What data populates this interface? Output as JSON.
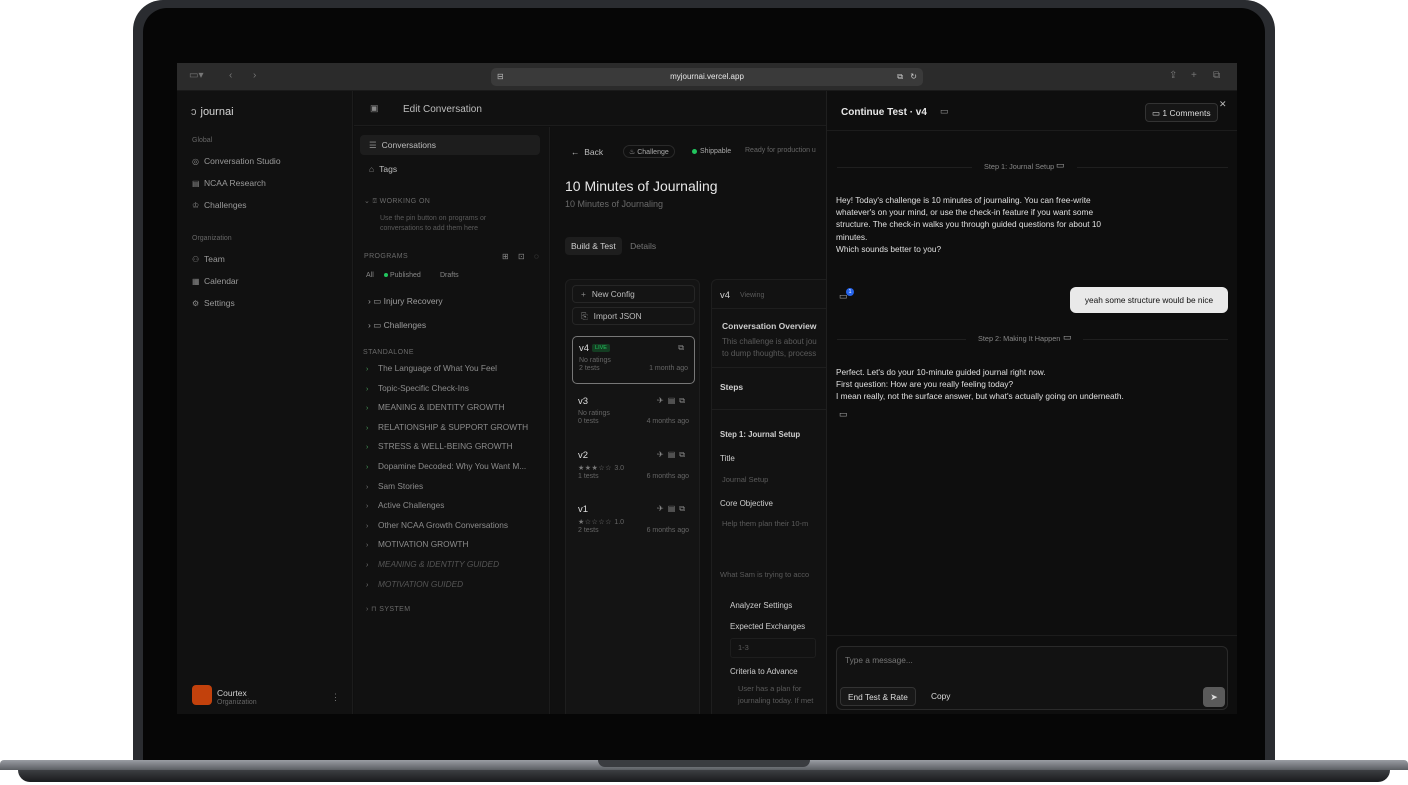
{
  "browser": {
    "url": "myjournai.vercel.app"
  },
  "app": {
    "logo": "journai",
    "header_title": "Edit Conversation"
  },
  "sidebar": {
    "global_label": "Global",
    "global_items": [
      "Conversation Studio",
      "NCAA Research",
      "Challenges"
    ],
    "org_label": "Organization",
    "org_items": [
      "Team",
      "Calendar",
      "Settings"
    ],
    "org_name": "Courtex",
    "org_sub": "Organization"
  },
  "convpanel": {
    "items": [
      "Conversations",
      "Tags"
    ],
    "working_on_label": "WORKING ON",
    "working_on_hint": "Use the pin button on programs or conversations to add them here",
    "programs_label": "PROGRAMS",
    "filters": [
      "All",
      "Published",
      "Drafts"
    ],
    "folders": [
      "Injury Recovery",
      "Challenges"
    ],
    "standalone_label": "STANDALONE",
    "standalone": [
      "The Language of What You Feel",
      "Topic-Specific Check-Ins",
      "MEANING & IDENTITY GROWTH",
      "RELATIONSHIP & SUPPORT GROWTH",
      "STRESS & WELL-BEING GROWTH",
      "Dopamine Decoded: Why You Want M...",
      "Sam Stories",
      "Active Challenges",
      "Other NCAA Growth Conversations",
      "MOTIVATION GROWTH",
      "MEANING & IDENTITY GUIDED",
      "MOTIVATION GUIDED"
    ],
    "system_label": "SYSTEM"
  },
  "main": {
    "back": "Back",
    "pill_challenge": "Challenge",
    "pill_shippable": "Shippable",
    "ready_text": "Ready for production u",
    "title": "10 Minutes of Journaling",
    "subtitle": "10 Minutes of Journaling",
    "tabs": [
      "Build & Test",
      "Details"
    ],
    "new_config": "New Config",
    "import_json": "Import JSON",
    "versions": [
      {
        "name": "v4",
        "live": "LIVE",
        "ratings": "No ratings",
        "tests": "2 tests",
        "age": "1 month ago",
        "rating": ""
      },
      {
        "name": "v3",
        "live": "",
        "ratings": "No ratings",
        "tests": "0 tests",
        "age": "4 months ago",
        "rating": ""
      },
      {
        "name": "v2",
        "live": "",
        "ratings": "",
        "tests": "1 tests",
        "age": "6 months ago",
        "rating": "3.0"
      },
      {
        "name": "v1",
        "live": "",
        "ratings": "",
        "tests": "2 tests",
        "age": "6 months ago",
        "rating": "1.0"
      }
    ],
    "detail": {
      "version": "v4",
      "viewing": "Viewing",
      "overview_title": "Conversation Overview",
      "overview_text1": "This challenge is about jou",
      "overview_text2": "to dump thoughts, process",
      "steps_label": "Steps",
      "step1": "Step 1: Journal Setup",
      "title_label": "Title",
      "title_value": "Journal Setup",
      "core_label": "Core Objective",
      "core_value": "Help them plan their 10-m",
      "sam_label": "What Sam is trying to acco",
      "analyzer_label": "Analyzer Settings",
      "exchanges_label": "Expected Exchanges",
      "exchanges_value": "1-3",
      "criteria_label": "Criteria to Advance",
      "criteria_value1": "User has a plan for",
      "criteria_value2": "journaling today. If met"
    }
  },
  "chat": {
    "title": "Continue Test · v4",
    "comments_btn": "1 Comments",
    "step1": "Step 1: Journal Setup",
    "msg1": [
      "Hey! Today's challenge is 10 minutes of journaling. You can free-write",
      "whatever's on your mind, or use the check-in feature if you want some",
      "structure. The check-in walks you through guided questions for about 10",
      "minutes.",
      "Which sounds better to you?"
    ],
    "badge": "1",
    "user_msg": "yeah some structure would be nice",
    "step2": "Step 2: Making It Happen",
    "msg2": [
      "Perfect. Let's do your 10-minute guided journal right now.",
      "First question: How are you really feeling today?",
      "I mean really, not the surface answer, but what's actually going on underneath."
    ],
    "placeholder": "Type a message...",
    "end_btn": "End Test & Rate",
    "copy_btn": "Copy"
  }
}
